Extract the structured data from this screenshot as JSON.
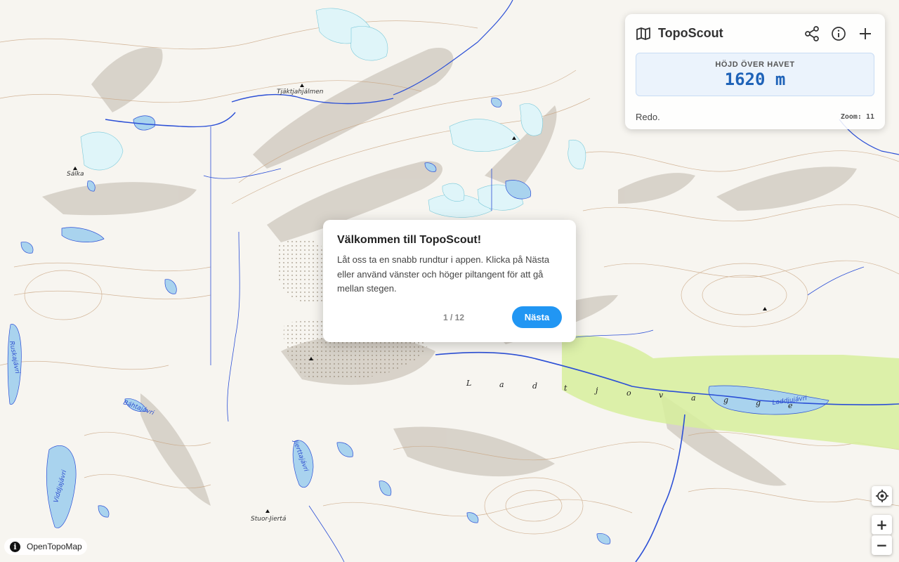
{
  "app": {
    "name": "TopoScout",
    "elevation_label": "HÖJD ÖVER HAVET",
    "elevation_value": "1620 m",
    "status": "Redo.",
    "zoom_readout": "Zoom: 11",
    "icons": {
      "app": "map-icon",
      "share": "share-icon",
      "info": "info-icon",
      "add": "plus-icon"
    }
  },
  "tour": {
    "title": "Välkommen till TopoScout!",
    "body": "Låt oss ta en snabb rundtur i appen. Klicka på Nästa eller använd vänster och höger piltangent för att gå mellan stegen.",
    "progress": "1 / 12",
    "next_label": "Nästa"
  },
  "map_controls": {
    "locate_icon": "crosshair-icon",
    "zoom_in": "+",
    "zoom_out": "−"
  },
  "attribution": {
    "icon": "i",
    "text": "OpenTopoMap"
  },
  "map_labels": {
    "peaks": [
      "Tjäktjahjálmen",
      "Sálka",
      "Stuor-Jiertá"
    ],
    "lakes": [
      "Ruskajávri",
      "Báhtajávri",
      "Viddjajávri",
      "Jierttajávri",
      "Laddjujávri"
    ],
    "valley_letters": [
      "L",
      "a",
      "d",
      "t",
      "j",
      "o",
      "v",
      "a",
      "g",
      "g",
      "e"
    ]
  },
  "colors": {
    "water": "#a9d3ee",
    "river": "#2b4fd6",
    "glacier": "#dff5f9",
    "contour": "#c9a582",
    "meadow": "#d7ee9c",
    "accent": "#2196f3",
    "elevation": "#1f63b8"
  }
}
